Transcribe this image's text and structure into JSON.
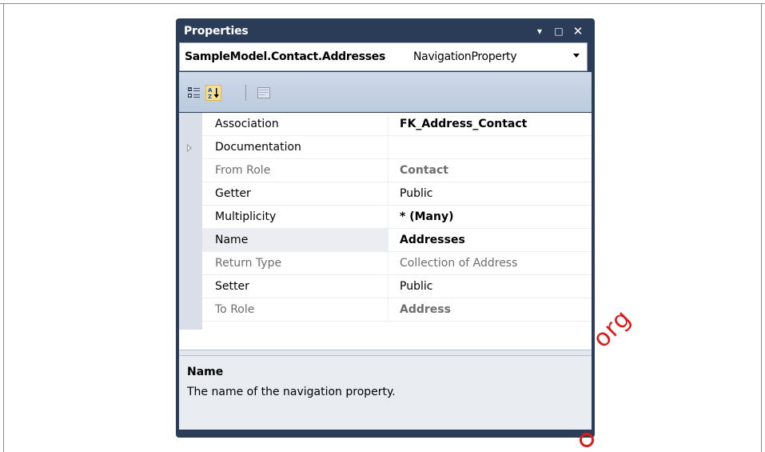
{
  "window": {
    "title": "Properties",
    "dropdown_glyph": "▾",
    "maximize_glyph": "□",
    "close_glyph": "✕"
  },
  "object_selector": {
    "name": "SampleModel.Contact.Addresses",
    "type": "NavigationProperty"
  },
  "toolbar": {
    "icons": [
      "categorized-view-icon",
      "alphabetical-sort-icon",
      "property-pages-icon"
    ]
  },
  "grid": {
    "rows": [
      {
        "name": "Association",
        "value": "FK_Address_Contact",
        "bold": true,
        "readonly": false,
        "expandable": false
      },
      {
        "name": "Documentation",
        "value": "",
        "bold": false,
        "readonly": false,
        "expandable": true
      },
      {
        "name": "From Role",
        "value": "Contact",
        "bold": true,
        "readonly": true,
        "expandable": false
      },
      {
        "name": "Getter",
        "value": "Public",
        "bold": false,
        "readonly": false,
        "expandable": false
      },
      {
        "name": "Multiplicity",
        "value": "* (Many)",
        "bold": true,
        "readonly": false,
        "expandable": false
      },
      {
        "name": "Name",
        "value": "Addresses",
        "bold": true,
        "readonly": false,
        "expandable": false,
        "selected": true
      },
      {
        "name": "Return Type",
        "value": "Collection of Address",
        "bold": false,
        "readonly": true,
        "expandable": false
      },
      {
        "name": "Setter",
        "value": "Public",
        "bold": false,
        "readonly": false,
        "expandable": false
      },
      {
        "name": "To Role",
        "value": "Address",
        "bold": true,
        "readonly": true,
        "expandable": false
      }
    ]
  },
  "description": {
    "title": "Name",
    "text": "The name of the navigation property."
  },
  "watermark": "org",
  "colors": {
    "title_bar": "#2b3c59",
    "toolbar": "#c6d2e3",
    "readonly_text": "#6d6d6d",
    "watermark": "#dd1a1a"
  }
}
